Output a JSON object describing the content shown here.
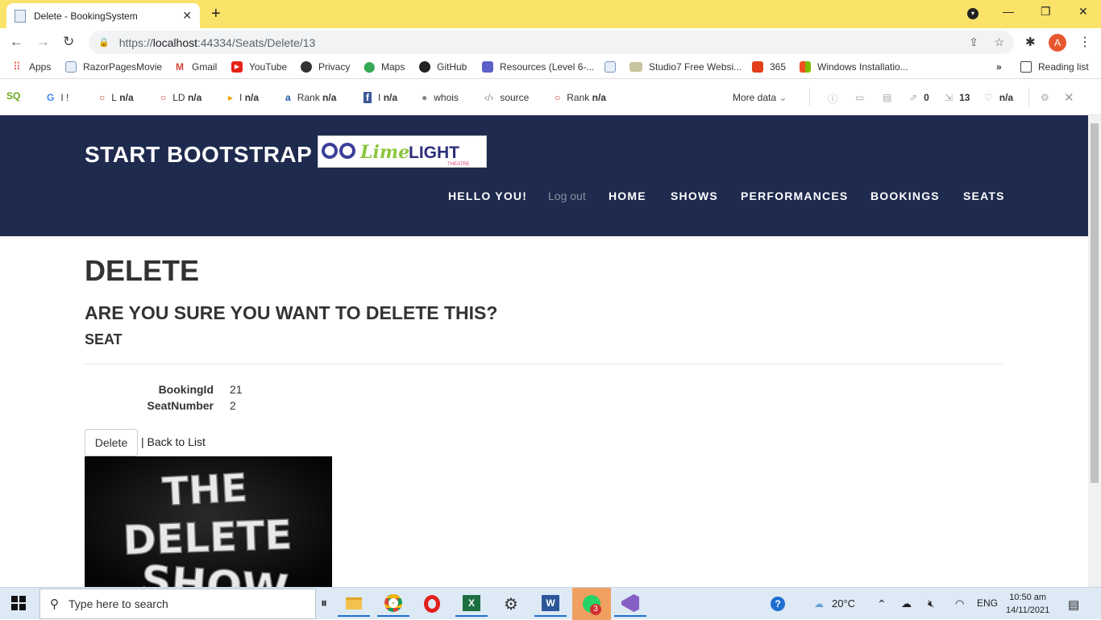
{
  "browser": {
    "tab_title": "Delete - BookingSystem",
    "tab_close": "✕",
    "new_tab": "+",
    "url_prefix": "https://",
    "url_host": "localhost",
    "url_rest": ":44334/Seats/Delete/13",
    "profile_initial": "A"
  },
  "bookmarks": [
    {
      "label": "Apps",
      "icon": "apps-grid-icon"
    },
    {
      "label": "RazorPagesMovie",
      "icon": "page-icon"
    },
    {
      "label": "Gmail",
      "icon": "gmail-icon"
    },
    {
      "label": "YouTube",
      "icon": "youtube-icon"
    },
    {
      "label": "Privacy",
      "icon": "globe-icon"
    },
    {
      "label": "Maps",
      "icon": "maps-icon"
    },
    {
      "label": "GitHub",
      "icon": "github-icon"
    },
    {
      "label": "Resources (Level 6-...",
      "icon": "teams-icon"
    },
    {
      "label": "",
      "icon": "page-icon"
    },
    {
      "label": "Studio7 Free Websi...",
      "icon": "studio-icon"
    },
    {
      "label": "365",
      "icon": "office-icon"
    },
    {
      "label": "Windows Installatio...",
      "icon": "windows-icon"
    }
  ],
  "bookmarks_more": "»",
  "reading_list": "Reading list",
  "seobar": {
    "g": "G",
    "g_val": "I   !",
    "l_prefix": "L",
    "l_val": "n/a",
    "ld_prefix": "LD",
    "ld_val": "n/a",
    "i_prefix": "I",
    "i_val": "n/a",
    "rank1_prefix": "Rank",
    "rank1_val": "n/a",
    "fb_prefix": "I",
    "fb_val": "n/a",
    "whois": "whois",
    "source": "source",
    "rank2_prefix": "Rank",
    "rank2_val": "n/a",
    "more_data": "More data",
    "links_ext": "0",
    "links_int": "13",
    "health": "n/a"
  },
  "site": {
    "brand": "START BOOTSTRAP",
    "logo_text": "Lime LIGHT",
    "logo_sub": "THEATRE",
    "nav": {
      "hello": "HELLO YOU!",
      "logout": "Log out",
      "home": "HOME",
      "shows": "SHOWS",
      "performances": "PERFORMANCES",
      "bookings": "BOOKINGS",
      "seats": "SEATS"
    }
  },
  "content": {
    "heading": "DELETE",
    "question": "ARE YOU SURE YOU WANT TO DELETE THIS?",
    "entity": "SEAT",
    "fields": [
      {
        "label": "BookingId",
        "value": "21"
      },
      {
        "label": "SeatNumber",
        "value": "2"
      }
    ],
    "delete_button": "Delete",
    "back_link": "| Back to List",
    "image_text": [
      "THE",
      "DELETE",
      "SHOW"
    ]
  },
  "taskbar": {
    "search_placeholder": "Type here to search",
    "temperature": "20°C",
    "language": "ENG",
    "time": "10:50 am",
    "date": "14/11/2021",
    "whatsapp_badge": "3"
  }
}
